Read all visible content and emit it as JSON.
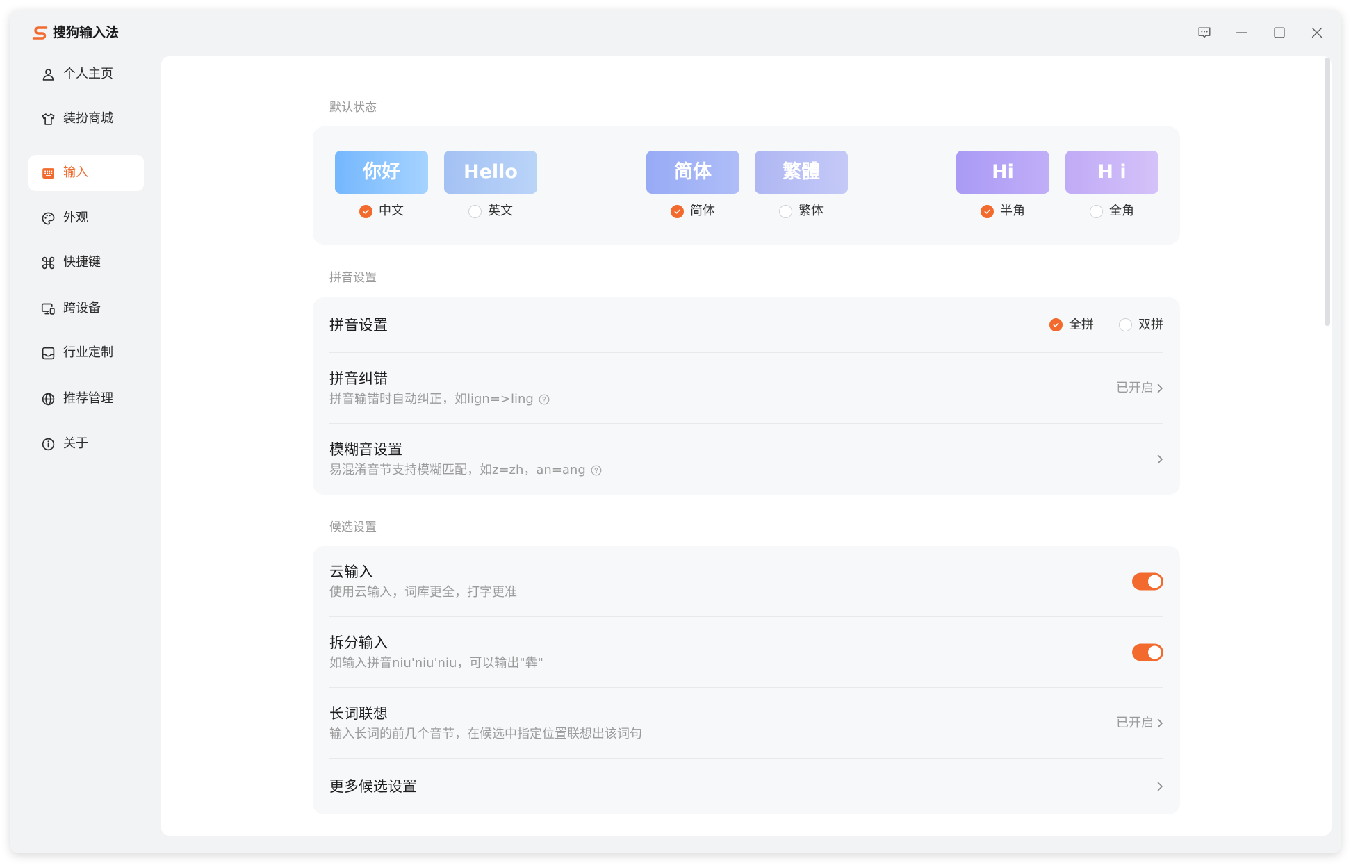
{
  "app": {
    "title": "搜狗输入法",
    "logo_icon": "sogou-logo-icon",
    "accent_color": "#f26a2d"
  },
  "title_bar": {
    "controls": [
      {
        "name": "feedback",
        "icon": "feedback-icon"
      },
      {
        "name": "minimize",
        "icon": "minimize-icon"
      },
      {
        "name": "maximize",
        "icon": "maximize-icon"
      },
      {
        "name": "close",
        "icon": "close-icon"
      }
    ]
  },
  "sidebar": {
    "items": [
      {
        "label": "个人主页",
        "icon": "user-icon",
        "selected": false
      },
      {
        "label": "装扮商城",
        "icon": "shirt-icon",
        "selected": false
      },
      {
        "label": "输入",
        "icon": "keyboard-icon",
        "selected": true
      },
      {
        "label": "外观",
        "icon": "palette-icon",
        "selected": false
      },
      {
        "label": "快捷键",
        "icon": "command-icon",
        "selected": false
      },
      {
        "label": "跨设备",
        "icon": "devices-icon",
        "selected": false
      },
      {
        "label": "行业定制",
        "icon": "tray-icon",
        "selected": false
      },
      {
        "label": "推荐管理",
        "icon": "globe-icon",
        "selected": false
      },
      {
        "label": "关于",
        "icon": "info-icon",
        "selected": false
      }
    ]
  },
  "default_state": {
    "section_label": "默认状态",
    "groups": [
      {
        "options": [
          {
            "tile": "你好",
            "label": "中文",
            "checked": true
          },
          {
            "tile": "Hello",
            "label": "英文",
            "checked": false
          }
        ]
      },
      {
        "options": [
          {
            "tile": "简体",
            "label": "简体",
            "checked": true
          },
          {
            "tile": "繁體",
            "label": "繁体",
            "checked": false
          }
        ]
      },
      {
        "options": [
          {
            "tile": "Hi",
            "label": "半角",
            "checked": true
          },
          {
            "tile": "H i",
            "label": "全角",
            "checked": false
          }
        ]
      }
    ]
  },
  "pinyin": {
    "section_label": "拼音设置",
    "mode": {
      "title": "拼音设置",
      "options": [
        {
          "label": "全拼",
          "checked": true
        },
        {
          "label": "双拼",
          "checked": false
        }
      ]
    },
    "correction": {
      "title": "拼音纠错",
      "subtitle": "拼音输错时自动纠正，如lign=>ling",
      "status": "已开启"
    },
    "fuzzy": {
      "title": "模糊音设置",
      "subtitle": "易混淆音节支持模糊匹配，如z=zh，an=ang"
    }
  },
  "candidates": {
    "section_label": "候选设置",
    "cloud": {
      "title": "云输入",
      "subtitle": "使用云输入，词库更全，打字更准",
      "enabled": true
    },
    "split": {
      "title": "拆分输入",
      "subtitle": "如输入拼音niu'niu'niu，可以输出\"犇\"",
      "enabled": true
    },
    "long_word": {
      "title": "长词联想",
      "subtitle": "输入长词的前几个音节，在候选中指定位置联想出该词句",
      "status": "已开启"
    },
    "more": {
      "title": "更多候选设置"
    }
  }
}
